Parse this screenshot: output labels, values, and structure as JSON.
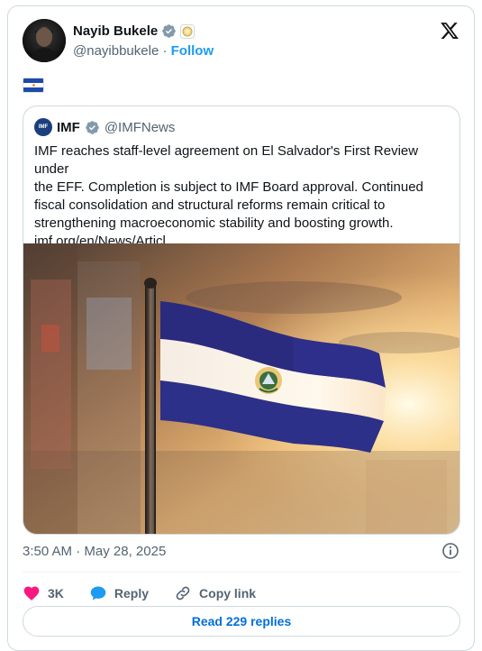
{
  "author": {
    "name": "Nayib Bukele",
    "handle": "@nayibbukele",
    "separator": "·",
    "follow_label": "Follow"
  },
  "tweet": {
    "flag_emoji": "El Salvador flag"
  },
  "quoted": {
    "avatar_text": "IMF",
    "name": "IMF",
    "handle": "@IMFNews",
    "text_lines": [
      "IMF reaches staff-level agreement on El Salvador's First Review under",
      "the EFF. Completion is subject to IMF Board approval. Continued",
      "fiscal consolidation and structural reforms remain critical to",
      "strengthening macroeconomic stability and boosting growth.",
      "imf.org/en/News/Articl..."
    ]
  },
  "meta": {
    "time": "3:50 AM",
    "separator": "·",
    "date": "May 28, 2025"
  },
  "actions": {
    "likes": "3K",
    "reply_label": "Reply",
    "copy_label": "Copy link"
  },
  "read_replies_label": "Read 229 replies",
  "colors": {
    "accent": "#1d9bf0",
    "like": "#f91880",
    "reply_icon": "#1d9bf0"
  },
  "icons": [
    "verified-badge-icon",
    "affiliate-badge-icon",
    "x-logo-icon",
    "info-icon",
    "heart-icon",
    "reply-bubble-icon",
    "link-icon"
  ]
}
